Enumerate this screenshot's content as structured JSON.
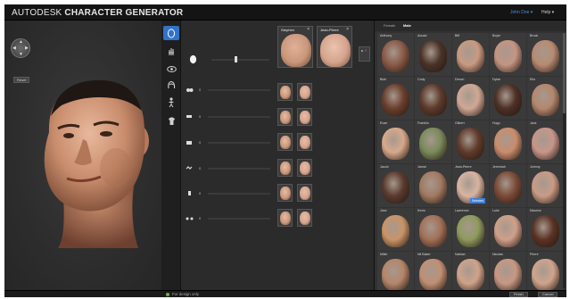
{
  "app": {
    "title_light": "AUTODESK",
    "title_bold": "CHARACTER GENERATOR",
    "user_menu": "John Doe ▾",
    "help_menu": "Help ▾"
  },
  "viewport": {
    "reset_label": "Reset",
    "nav_arrows": [
      "▲",
      "▼",
      "◀",
      "▶"
    ]
  },
  "tools": [
    {
      "icon": "head-icon",
      "active": true
    },
    {
      "icon": "hand-icon",
      "active": false
    },
    {
      "icon": "eye-icon",
      "active": false
    },
    {
      "icon": "hair-icon",
      "active": false
    },
    {
      "icon": "body-icon",
      "active": false
    },
    {
      "icon": "clothing-icon",
      "active": false
    }
  ],
  "blend_targets": [
    {
      "name": "Stephen",
      "close": "×",
      "skin": "#c9977a"
    },
    {
      "name": "Jean-Pierre",
      "close": "×",
      "skin": "#d4a48e"
    }
  ],
  "blend_arrows": "▸ ⁘",
  "mix_rows": [
    {
      "value": "0",
      "icon": "face-shape-icon"
    },
    {
      "value": "0",
      "icon": "forehead-icon"
    },
    {
      "value": "0",
      "icon": "nose-icon"
    },
    {
      "value": "0",
      "icon": "mouth-icon"
    },
    {
      "value": "0",
      "icon": "chin-icon"
    },
    {
      "value": "0",
      "icon": "ears-icon"
    }
  ],
  "library": {
    "tabs": [
      "Female",
      "Male"
    ],
    "active_tab": 1,
    "items": [
      {
        "name": "Anthony",
        "skin": "#8a5a48"
      },
      {
        "name": "Aouad",
        "skin": "#4a3328"
      },
      {
        "name": "Biff",
        "skin": "#c89a82"
      },
      {
        "name": "Boyle",
        "skin": "#c49582"
      },
      {
        "name": "Brock",
        "skin": "#b78b72"
      },
      {
        "name": "Buki",
        "skin": "#6b3f2e"
      },
      {
        "name": "Cody",
        "skin": "#5c3a2c"
      },
      {
        "name": "Devon",
        "skin": "#cfa894"
      },
      {
        "name": "Dylan",
        "skin": "#4d3026"
      },
      {
        "name": "Elio",
        "skin": "#b4876e"
      },
      {
        "name": "Evan",
        "skin": "#d7a98c"
      },
      {
        "name": "Franklin",
        "skin": "#7a8a5a"
      },
      {
        "name": "Gilbert",
        "skin": "#5f3b2c"
      },
      {
        "name": "Hugo",
        "skin": "#c98d6d"
      },
      {
        "name": "Jack",
        "skin": "#c7968a"
      },
      {
        "name": "Jacob",
        "skin": "#5a3a2e"
      },
      {
        "name": "Jamal",
        "skin": "#a27a62"
      },
      {
        "name": "Jean-Pierre",
        "skin": "#d8b4a2",
        "badge": "Selected"
      },
      {
        "name": "Jeremiah",
        "skin": "#7a4b38"
      },
      {
        "name": "Johnny",
        "skin": "#c99b86"
      },
      {
        "name": "Jose",
        "skin": "#c99468"
      },
      {
        "name": "Kevin",
        "skin": "#a27058"
      },
      {
        "name": "Lawrence",
        "skin": "#8f9a5e"
      },
      {
        "name": "Luke",
        "skin": "#cfa08a"
      },
      {
        "name": "Maurice",
        "skin": "#5a3326"
      },
      {
        "name": "Miller",
        "skin": "#b4866a"
      },
      {
        "name": "Nil Baker",
        "skin": "#c08f74"
      },
      {
        "name": "Nathan",
        "skin": "#cfa38a"
      },
      {
        "name": "Nicolas",
        "skin": "#c79884"
      },
      {
        "name": "Pierre",
        "skin": "#d0a48c"
      }
    ]
  },
  "status": {
    "text": "For design only",
    "finish_label": "Finish",
    "cancel_label": "Cancel"
  }
}
